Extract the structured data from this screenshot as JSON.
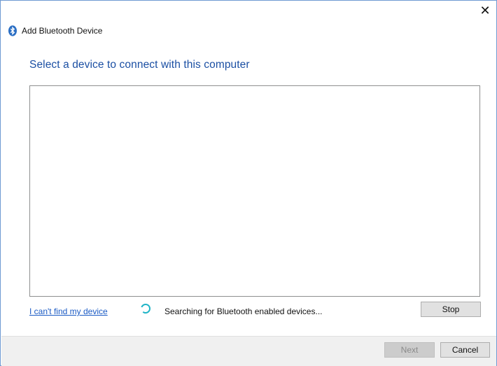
{
  "window": {
    "title": "Add Bluetooth Device",
    "close_glyph": "✕"
  },
  "main": {
    "heading": "Select a device to connect with this computer",
    "help_link": "I can't find my device",
    "status": "Searching for Bluetooth enabled devices...",
    "stop_label": "Stop"
  },
  "footer": {
    "next_label": "Next",
    "cancel_label": "Cancel"
  },
  "icons": {
    "title_icon": "bluetooth-icon",
    "status_icon": "spinner-icon",
    "close_icon": "close-icon"
  },
  "colors": {
    "heading": "#1b4fa3",
    "link": "#1a5ac4",
    "spinner": "#1fb4c6",
    "window_border": "#6f9ad2"
  }
}
